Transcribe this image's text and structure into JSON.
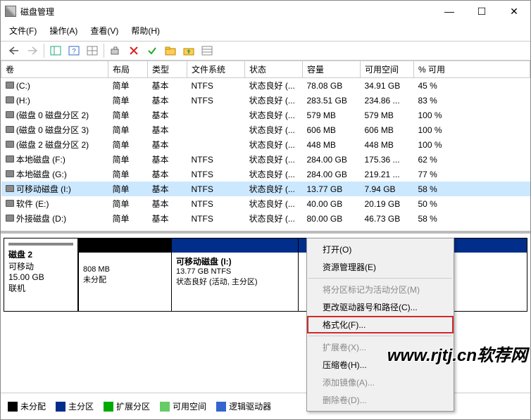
{
  "window": {
    "title": "磁盘管理",
    "min": "—",
    "max": "☐",
    "close": "✕"
  },
  "menu": {
    "file": "文件(F)",
    "action": "操作(A)",
    "view": "查看(V)",
    "help": "帮助(H)"
  },
  "columns": {
    "vol": "卷",
    "layout": "布局",
    "type": "类型",
    "fs": "文件系统",
    "status": "状态",
    "cap": "容量",
    "free": "可用空间",
    "pct": "% 可用"
  },
  "rows": [
    {
      "vol": "(C:)",
      "layout": "简单",
      "type": "基本",
      "fs": "NTFS",
      "status": "状态良好 (...",
      "cap": "78.08 GB",
      "free": "34.91 GB",
      "pct": "45 %"
    },
    {
      "vol": "(H:)",
      "layout": "简单",
      "type": "基本",
      "fs": "NTFS",
      "status": "状态良好 (...",
      "cap": "283.51 GB",
      "free": "234.86 ...",
      "pct": "83 %"
    },
    {
      "vol": "(磁盘 0 磁盘分区 2)",
      "layout": "简单",
      "type": "基本",
      "fs": "",
      "status": "状态良好 (...",
      "cap": "579 MB",
      "free": "579 MB",
      "pct": "100 %"
    },
    {
      "vol": "(磁盘 0 磁盘分区 3)",
      "layout": "简单",
      "type": "基本",
      "fs": "",
      "status": "状态良好 (...",
      "cap": "606 MB",
      "free": "606 MB",
      "pct": "100 %"
    },
    {
      "vol": "(磁盘 2 磁盘分区 2)",
      "layout": "简单",
      "type": "基本",
      "fs": "",
      "status": "状态良好 (...",
      "cap": "448 MB",
      "free": "448 MB",
      "pct": "100 %"
    },
    {
      "vol": "本地磁盘 (F:)",
      "layout": "简单",
      "type": "基本",
      "fs": "NTFS",
      "status": "状态良好 (...",
      "cap": "284.00 GB",
      "free": "175.36 ...",
      "pct": "62 %"
    },
    {
      "vol": "本地磁盘 (G:)",
      "layout": "简单",
      "type": "基本",
      "fs": "NTFS",
      "status": "状态良好 (...",
      "cap": "284.00 GB",
      "free": "219.21 ...",
      "pct": "77 %"
    },
    {
      "vol": "可移动磁盘 (I:)",
      "layout": "简单",
      "type": "基本",
      "fs": "NTFS",
      "status": "状态良好 (...",
      "cap": "13.77 GB",
      "free": "7.94 GB",
      "pct": "58 %",
      "selected": true
    },
    {
      "vol": "软件 (E:)",
      "layout": "简单",
      "type": "基本",
      "fs": "NTFS",
      "status": "状态良好 (...",
      "cap": "40.00 GB",
      "free": "20.19 GB",
      "pct": "50 %"
    },
    {
      "vol": "外接磁盘 (D:)",
      "layout": "简单",
      "type": "基本",
      "fs": "NTFS",
      "status": "状态良好 (...",
      "cap": "80.00 GB",
      "free": "46.73 GB",
      "pct": "58 %"
    }
  ],
  "disk": {
    "name": "磁盘 2",
    "removable": "可移动",
    "cap": "15.00 GB",
    "online": "联机",
    "p1_size": "808 MB",
    "p1_state": "未分配",
    "p2_name": "可移动磁盘  (I:)",
    "p2_size": "13.77 GB NTFS",
    "p2_state": "状态良好 (活动, 主分区)"
  },
  "ctx": {
    "open": "打开(O)",
    "explorer": "资源管理器(E)",
    "active": "将分区标记为活动分区(M)",
    "drive": "更改驱动器号和路径(C)...",
    "format": "格式化(F)...",
    "extend": "扩展卷(X)...",
    "shrink": "压缩卷(H)...",
    "mirror": "添加镜像(A)...",
    "delete": "删除卷(D)..."
  },
  "legend": {
    "unalloc": "未分配",
    "primary": "主分区",
    "ext": "扩展分区",
    "free": "可用空间",
    "logical": "逻辑驱动器"
  },
  "watermark": "www.rjtj.cn软荐网"
}
